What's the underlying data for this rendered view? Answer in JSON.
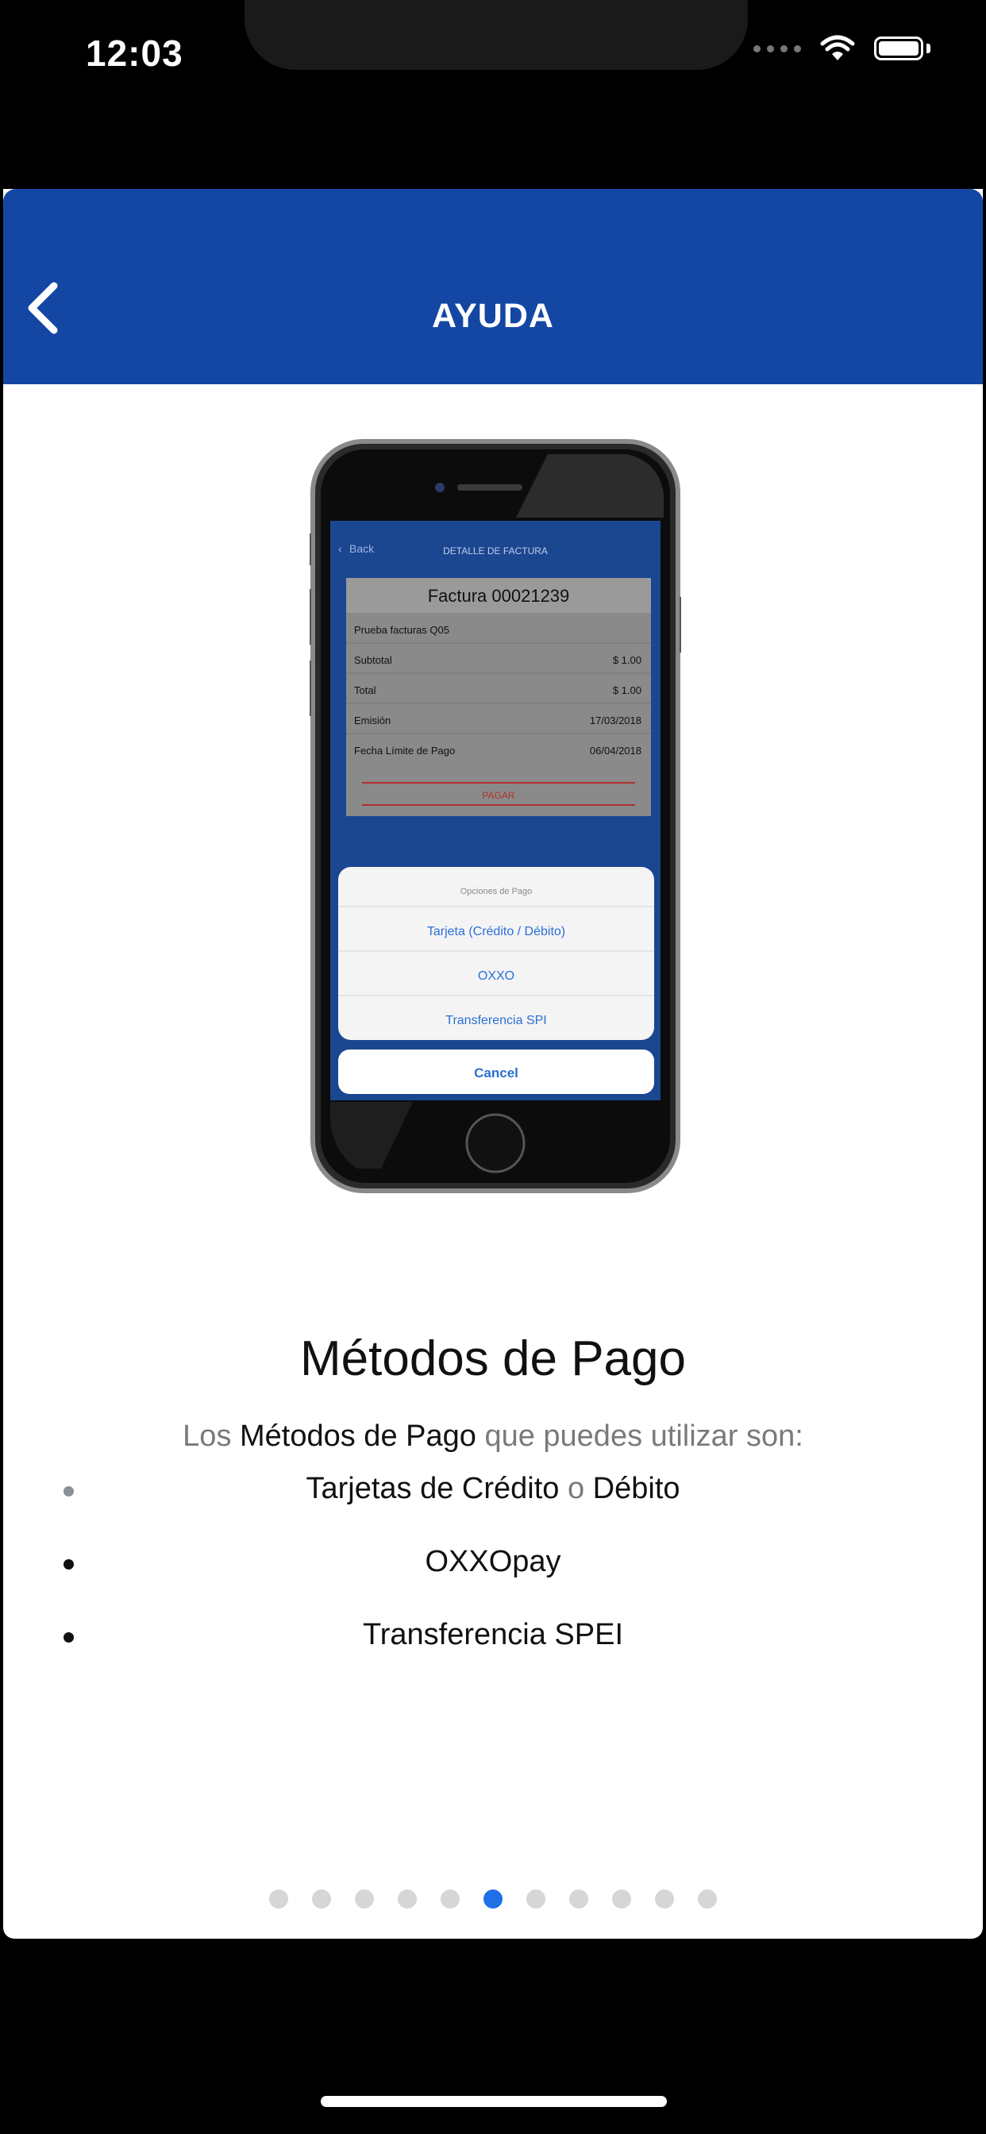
{
  "status_bar": {
    "time": "12:03"
  },
  "nav": {
    "title": "AYUDA"
  },
  "mockup": {
    "back": "Back",
    "header": "DETALLE DE FACTURA",
    "invoice_title": "Factura 00021239",
    "invoice_desc": "Prueba facturas Q05",
    "rows": [
      {
        "label": "Subtotal",
        "value": "$ 1.00"
      },
      {
        "label": "Total",
        "value": "$ 1.00"
      },
      {
        "label": "Emisión",
        "value": "17/03/2018"
      },
      {
        "label": "Fecha Límite de Pago",
        "value": "06/04/2018"
      }
    ],
    "pay_label": "PAGAR",
    "sheet_title": "Opciones de Pago",
    "options": [
      "Tarjeta (Crédito / Débito)",
      "OXXO",
      "Transferencia SPI"
    ],
    "cancel": "Cancel"
  },
  "content": {
    "title": "Métodos de Pago",
    "intro_1": "Los ",
    "intro_bold": "Métodos de Pago",
    "intro_2": " que puedes utilizar son:",
    "bullet_1_a": "Tarjetas de Crédito",
    "bullet_1_b": " o ",
    "bullet_1_c": "Débito",
    "bullet_2": "OXXOpay",
    "bullet_3": "Transferencia SPEI"
  },
  "pager": {
    "count": 11,
    "active_index": 5
  },
  "colors": {
    "navbar": "#1347a3",
    "active_dot": "#1f6fe6"
  }
}
